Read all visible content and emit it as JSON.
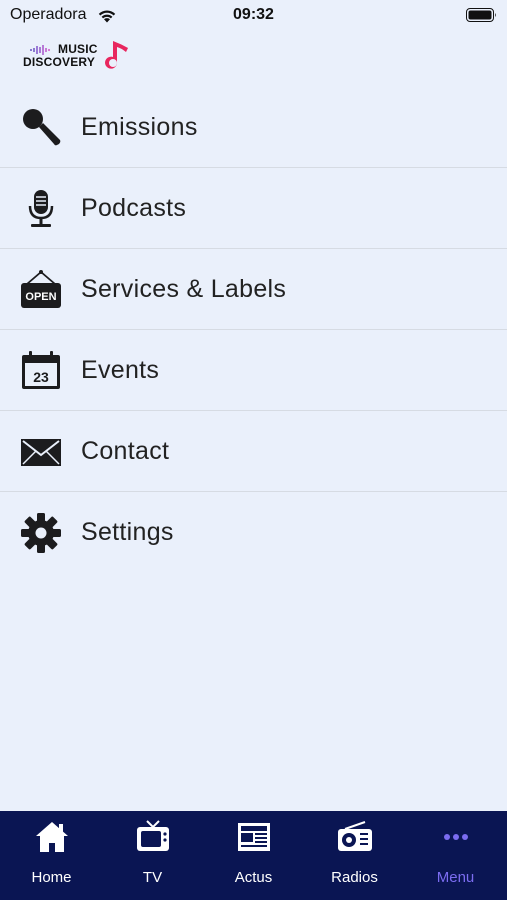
{
  "status_bar": {
    "carrier": "Operadora",
    "time": "09:32"
  },
  "logo": {
    "line1": "MUSIC",
    "line2": "DISCOVERY",
    "accent_color": "#e8265e"
  },
  "menu": {
    "items": [
      {
        "label": "Emissions",
        "icon": "microphone-icon"
      },
      {
        "label": "Podcasts",
        "icon": "podcast-mic-icon"
      },
      {
        "label": "Services & Labels",
        "icon": "open-sign-icon",
        "icon_text": "OPEN"
      },
      {
        "label": "Events",
        "icon": "calendar-icon",
        "icon_text": "23"
      },
      {
        "label": "Contact",
        "icon": "envelope-icon"
      },
      {
        "label": "Settings",
        "icon": "gear-icon"
      }
    ]
  },
  "tab_bar": {
    "background": "#0a1553",
    "active_color": "#7b6cf0",
    "tabs": [
      {
        "label": "Home",
        "icon": "home-icon"
      },
      {
        "label": "TV",
        "icon": "tv-icon"
      },
      {
        "label": "Actus",
        "icon": "newspaper-icon"
      },
      {
        "label": "Radios",
        "icon": "radio-icon"
      },
      {
        "label": "Menu",
        "icon": "more-icon",
        "active": true
      }
    ]
  }
}
